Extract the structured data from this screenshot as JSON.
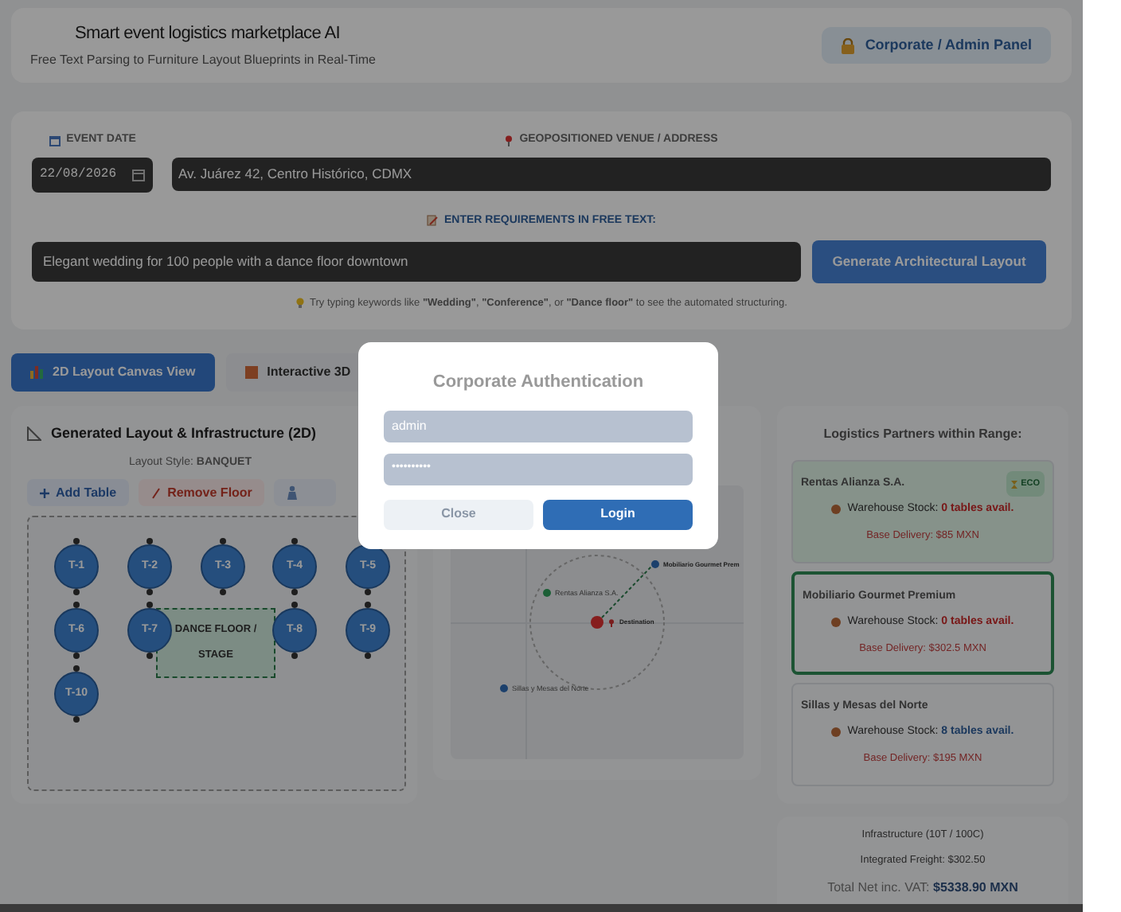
{
  "header": {
    "title": "Smart event logistics marketplace AI",
    "subtitle": "Free Text Parsing to Furniture Layout Blueprints in Real-Time",
    "admin_button": "Corporate / Admin Panel"
  },
  "form": {
    "date_label": "EVENT DATE",
    "date_value": "22/08/2026",
    "venue_label": "GEOPOSITIONED VENUE / ADDRESS",
    "venue_value": "Av. Juárez 42, Centro Histórico, CDMX",
    "requirements_label": "ENTER REQUIREMENTS IN FREE TEXT:",
    "requirements_value": "Elegant wedding for 100 people with a dance floor downtown",
    "generate_button": "Generate Architectural Layout",
    "hint": "Try typing keywords like **\"Wedding\"**, **\"Conference\"**, or **\"Dance floor\"** to see the automated structuring."
  },
  "tabs": [
    {
      "label": "2D Layout Canvas View",
      "selected": true
    },
    {
      "label": "Interactive 3D",
      "selected": false
    }
  ],
  "layout_panel": {
    "title": "Generated Layout & Infrastructure (2D)",
    "style_label": "Layout Style:",
    "style_value": "BANQUET",
    "actions": [
      {
        "kind": "add",
        "label": "Add Table"
      },
      {
        "kind": "remove",
        "label": "Remove Floor"
      },
      {
        "kind": "faded"
      }
    ],
    "tables": [
      "T-1",
      "T-2",
      "T-3",
      "T-4",
      "T-5",
      "T-6",
      "T-7",
      "T-8",
      "T-9",
      "T-10"
    ],
    "floor": "DANCE FLOOR / STAGE"
  },
  "map": {
    "markers": [
      {
        "kind": "partner",
        "label": "Mobiliario Gourmet Prem",
        "color": "#1c416c"
      },
      {
        "kind": "partner",
        "label": "Rentas Alianza S.A.",
        "color": "#1c5f36"
      },
      {
        "kind": "destination",
        "label": "Destination",
        "color": "#861e1e"
      },
      {
        "kind": "partner",
        "label": "Sillas y Mesas del Norte",
        "color": "#1c416c"
      }
    ]
  },
  "partners": {
    "title": "Logistics Partners within Range:",
    "items": [
      {
        "name": "Rentas Alianza S.A.",
        "eco": true,
        "eco_label": "ECO",
        "selected": false,
        "stock_label": "Warehouse Stock:",
        "stock_value": "0 tables avail.",
        "available": false,
        "delivery": "Base Delivery: $85 MXN"
      },
      {
        "name": "Mobiliario Gourmet Premium",
        "eco": false,
        "selected": true,
        "stock_label": "Warehouse Stock:",
        "stock_value": "0 tables avail.",
        "available": false,
        "delivery": "Base Delivery: $302.5 MXN"
      },
      {
        "name": "Sillas y Mesas del Norte",
        "eco": false,
        "selected": false,
        "stock_label": "Warehouse Stock:",
        "stock_value": "8 tables avail.",
        "available": true,
        "delivery": "Base Delivery: $195 MXN"
      }
    ]
  },
  "totals": {
    "infrastructure": "Infrastructure (10T / 100C)",
    "freight": "Integrated Freight: $302.50",
    "total_label": "Total Net inc. VAT:",
    "total_value": "$5338.90 MXN"
  },
  "modal": {
    "title": "Corporate Authentication",
    "username": "admin",
    "password": "••••••••••",
    "close_button": "Close",
    "login_button": "Login"
  }
}
